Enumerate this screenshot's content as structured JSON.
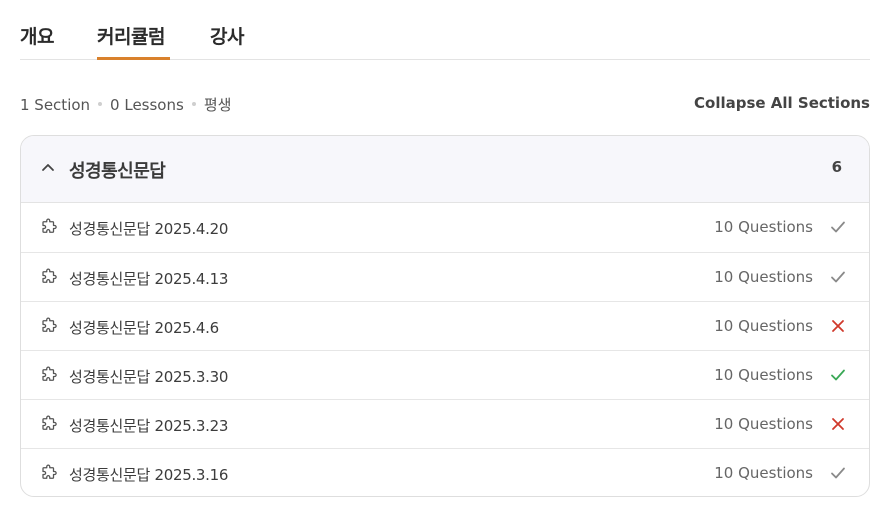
{
  "tabs": [
    {
      "label": "개요"
    },
    {
      "label": "커리큘럼"
    },
    {
      "label": "강사"
    }
  ],
  "meta": {
    "sections": "1 Section",
    "lessons": "0 Lessons",
    "duration": "평생",
    "collapse_all": "Collapse All Sections"
  },
  "section": {
    "title": "성경통신문답",
    "count": "6",
    "items": [
      {
        "title": "성경통신문답 2025.4.20",
        "questions": "10 Questions",
        "status": "completed"
      },
      {
        "title": "성경통신문답 2025.4.13",
        "questions": "10 Questions",
        "status": "completed"
      },
      {
        "title": "성경통신문답 2025.4.6",
        "questions": "10 Questions",
        "status": "failed"
      },
      {
        "title": "성경통신문답 2025.3.30",
        "questions": "10 Questions",
        "status": "passed"
      },
      {
        "title": "성경통신문답 2025.3.23",
        "questions": "10 Questions",
        "status": "failed"
      },
      {
        "title": "성경통신문답 2025.3.16",
        "questions": "10 Questions",
        "status": "completed"
      }
    ]
  },
  "colors": {
    "accent": "#d9812c",
    "check_gray": "#8a8a8a",
    "check_green": "#3aa856",
    "cross_red": "#d0392b"
  },
  "icons": {
    "item_icon": "puzzle-icon",
    "toggle_icon": "chevron-up-icon"
  }
}
